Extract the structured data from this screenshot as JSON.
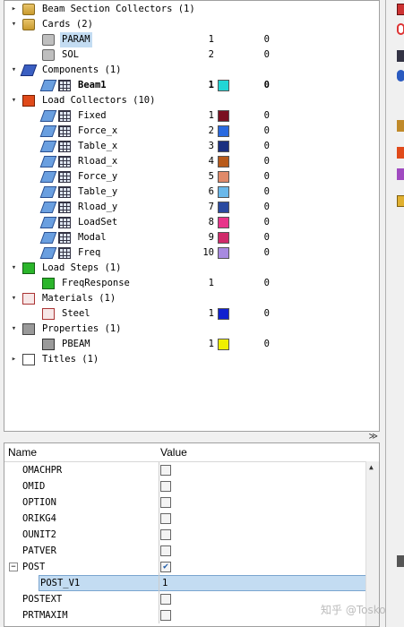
{
  "tree": [
    {
      "label": "Beam Section Collectors (1)",
      "level": 0,
      "toggle": "",
      "icon": "beam-section-collector-icon",
      "icls": "i-folder"
    },
    {
      "label": "Cards (2)",
      "level": 0,
      "toggle": "−",
      "icon": "cards-folder-icon",
      "icls": "i-folder"
    },
    {
      "label": "PARAM",
      "level": 1,
      "icon": "card-icon",
      "icls": "i-card",
      "id": "1",
      "count": "0",
      "selected": true
    },
    {
      "label": "SOL",
      "level": 1,
      "icon": "card-icon",
      "icls": "i-card",
      "id": "2",
      "count": "0"
    },
    {
      "label": "Components (1)",
      "level": 0,
      "toggle": "−",
      "icon": "components-folder-icon",
      "icls": "i-comp"
    },
    {
      "label": "Beam1",
      "level": 1,
      "icon": "component-icon",
      "icls": "i-grid",
      "id": "1",
      "color": "#22d6d6",
      "count": "0",
      "bold": true,
      "extra": "i-coll"
    },
    {
      "label": "Load Collectors (10)",
      "level": 0,
      "toggle": "−",
      "icon": "load-collectors-folder-icon",
      "icls": "i-load"
    },
    {
      "label": "Fixed",
      "level": 1,
      "icon": "load-collector-icon",
      "icls": "i-grid",
      "id": "1",
      "color": "#7a1020",
      "count": "0",
      "extra": "i-coll"
    },
    {
      "label": "Force_x",
      "level": 1,
      "icon": "load-collector-icon",
      "icls": "i-grid",
      "id": "2",
      "color": "#2a6ae0",
      "count": "0",
      "extra": "i-coll"
    },
    {
      "label": "Table_x",
      "level": 1,
      "icon": "load-collector-icon",
      "icls": "i-grid",
      "id": "3",
      "color": "#1a2f80",
      "count": "0",
      "extra": "i-coll"
    },
    {
      "label": "Rload_x",
      "level": 1,
      "icon": "load-collector-icon",
      "icls": "i-grid",
      "id": "4",
      "color": "#b85a1a",
      "count": "0",
      "extra": "i-coll"
    },
    {
      "label": "Force_y",
      "level": 1,
      "icon": "load-collector-icon",
      "icls": "i-grid",
      "id": "5",
      "color": "#e08a6a",
      "count": "0",
      "extra": "i-coll"
    },
    {
      "label": "Table_y",
      "level": 1,
      "icon": "load-collector-icon",
      "icls": "i-grid",
      "id": "6",
      "color": "#6ab8ea",
      "count": "0",
      "extra": "i-coll"
    },
    {
      "label": "Rload_y",
      "level": 1,
      "icon": "load-collector-icon",
      "icls": "i-grid",
      "id": "7",
      "color": "#2a4aa0",
      "count": "0",
      "extra": "i-coll"
    },
    {
      "label": "LoadSet",
      "level": 1,
      "icon": "load-collector-icon",
      "icls": "i-grid",
      "id": "8",
      "color": "#e8348a",
      "count": "0",
      "extra": "i-coll"
    },
    {
      "label": "Modal",
      "level": 1,
      "icon": "load-collector-icon",
      "icls": "i-grid",
      "id": "9",
      "color": "#d02a6a",
      "count": "0",
      "extra": "i-coll"
    },
    {
      "label": "Freq",
      "level": 1,
      "icon": "load-collector-icon",
      "icls": "i-grid",
      "id": "10",
      "color": "#a88ae0",
      "count": "0",
      "extra": "i-coll"
    },
    {
      "label": "Load Steps (1)",
      "level": 0,
      "toggle": "−",
      "icon": "load-steps-folder-icon",
      "icls": "i-step"
    },
    {
      "label": "FreqResponse",
      "level": 1,
      "icon": "load-step-icon",
      "icls": "i-step",
      "id": "1",
      "count": "0"
    },
    {
      "label": "Materials (1)",
      "level": 0,
      "toggle": "−",
      "icon": "materials-folder-icon",
      "icls": "i-mat"
    },
    {
      "label": "Steel",
      "level": 1,
      "icon": "material-icon",
      "icls": "i-mat",
      "id": "1",
      "color": "#1020d0",
      "count": "0"
    },
    {
      "label": "Properties (1)",
      "level": 0,
      "toggle": "−",
      "icon": "properties-folder-icon",
      "icls": "i-prop"
    },
    {
      "label": "PBEAM",
      "level": 1,
      "icon": "property-icon",
      "icls": "i-cube",
      "id": "1",
      "color": "#f0f000",
      "count": "0"
    },
    {
      "label": "Titles (1)",
      "level": 0,
      "toggle": "",
      "icon": "titles-folder-icon",
      "icls": "i-title"
    }
  ],
  "props": {
    "col_name": "Name",
    "col_value": "Value",
    "rows": [
      {
        "name": "OMACHPR",
        "checked": false
      },
      {
        "name": "OMID",
        "checked": false
      },
      {
        "name": "OPTION",
        "checked": false
      },
      {
        "name": "ORIKG4",
        "checked": false
      },
      {
        "name": "OUNIT2",
        "checked": false
      },
      {
        "name": "PATVER",
        "checked": false
      },
      {
        "name": "POST",
        "checked": true,
        "toggle": "−",
        "indent": 0
      },
      {
        "name": "POST_V1",
        "value": "1",
        "selected": true
      },
      {
        "name": "POSTEXT",
        "checked": false
      },
      {
        "name": "PRTMAXIM",
        "checked": false
      }
    ]
  },
  "watermark": "知乎 @Tosko"
}
